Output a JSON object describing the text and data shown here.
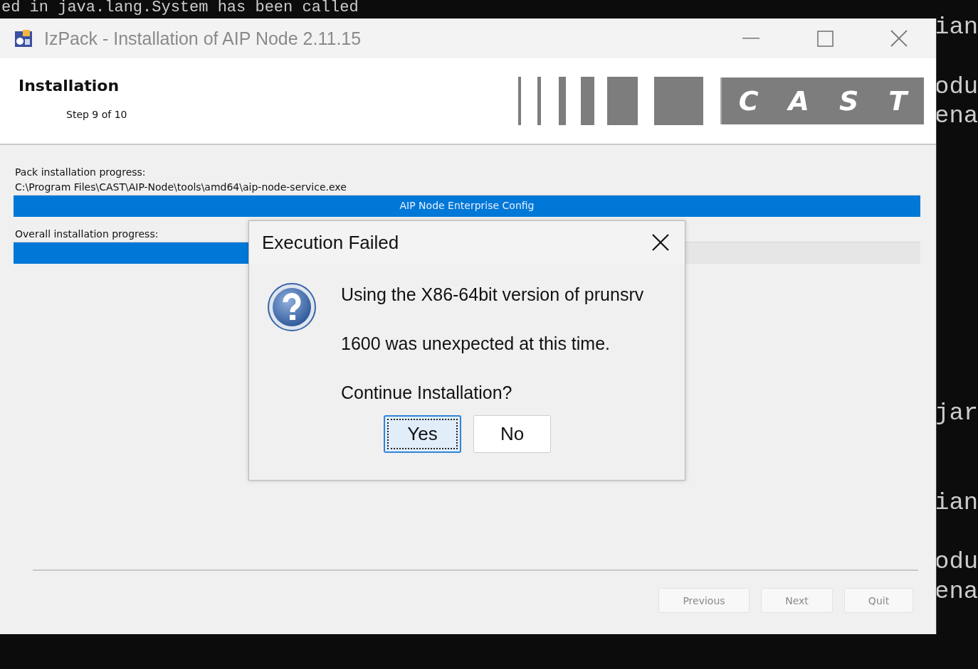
{
  "terminal": {
    "lines": [
      "ed in java.lang.System has been called",
      "ian",
      "odu",
      "ena",
      "jar",
      "ian",
      "odu",
      "ena"
    ]
  },
  "window": {
    "title": "IzPack - Installation of AIP Node 2.11.15"
  },
  "header": {
    "title": "Installation",
    "step": "Step 9 of 10",
    "logo": "CAST"
  },
  "progress": {
    "pack": {
      "label": "Pack installation progress:",
      "file": "C:\\Program Files\\CAST\\AIP-Node\\tools\\amd64\\aip-node-service.exe",
      "level": 1,
      "text": "AIP Node Enterprise Config"
    },
    "overall": {
      "label": "Overall installation progress:",
      "level": 0.3
    }
  },
  "nav_buttons": [
    {
      "label": "Previous",
      "disabled": true
    },
    {
      "label": "Next",
      "disabled": true
    },
    {
      "label": "Quit",
      "disabled": true
    }
  ],
  "dialog": {
    "title": "Execution Failed",
    "lines": [
      "Using the X86-64bit version of prunsrv",
      "1600 was unexpected at this time.",
      "Continue Installation?"
    ],
    "buttons": [
      {
        "label": "Yes",
        "focused": true
      },
      {
        "label": "No",
        "focused": false
      }
    ]
  }
}
